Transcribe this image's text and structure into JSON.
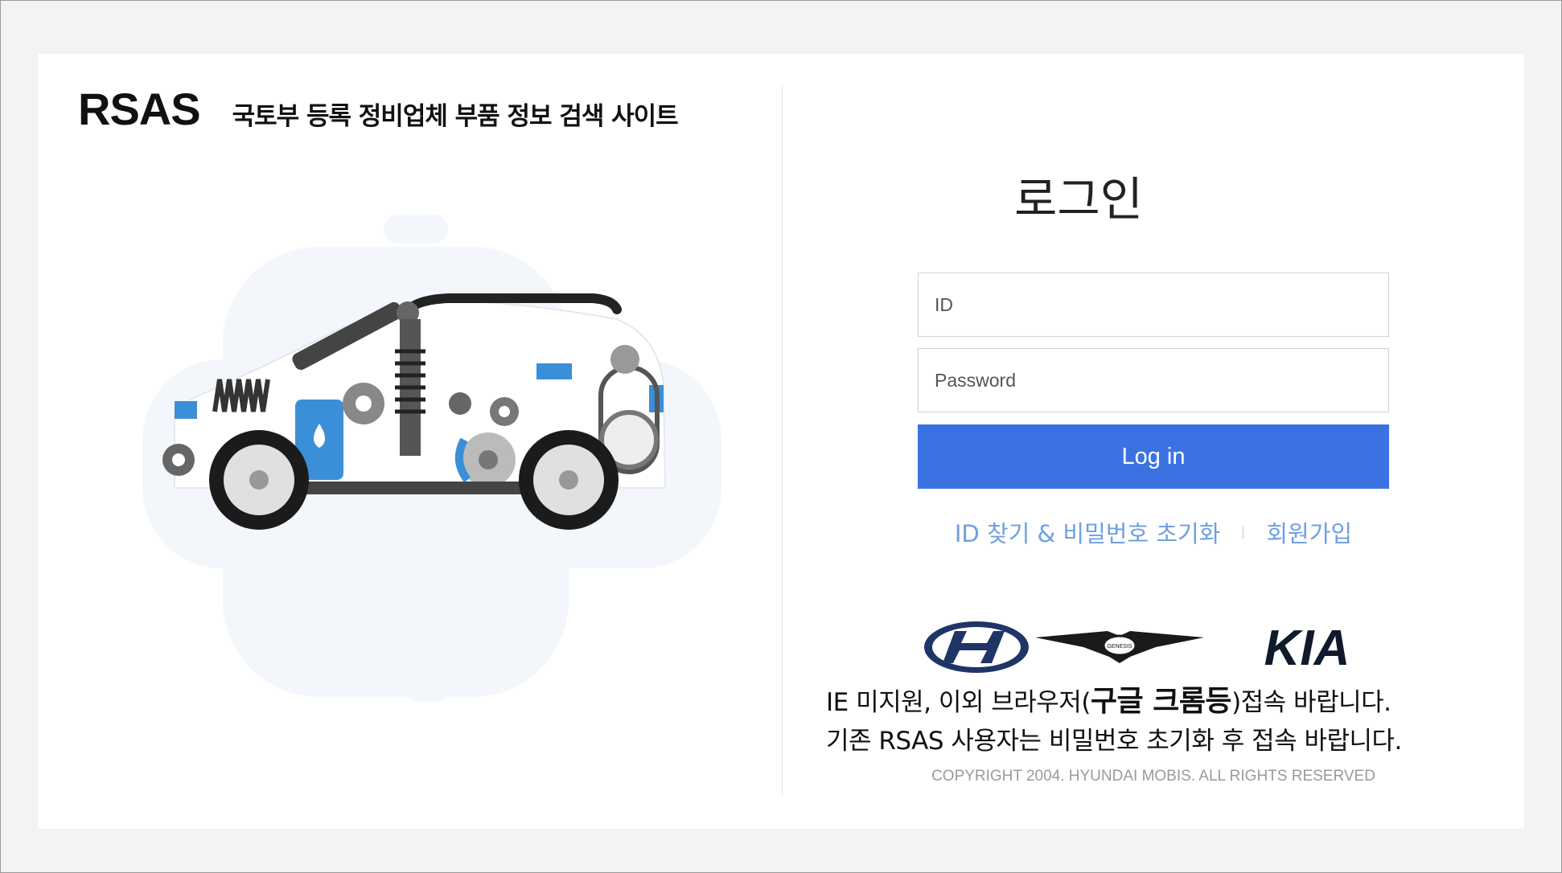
{
  "brand": {
    "logo": "RSAS",
    "subtitle": "국토부 등록 정비업체 부품 정보 검색 사이트"
  },
  "login": {
    "title": "로그인",
    "id_placeholder": "ID",
    "password_placeholder": "Password",
    "button_label": "Log in",
    "find_link": "ID 찾기 & 비밀번호 초기화",
    "signup_link": "회원가입"
  },
  "logos": [
    "hyundai-logo",
    "genesis-logo",
    "kia-logo"
  ],
  "logo_text": {
    "genesis": "GENESIS",
    "kia": "KIA"
  },
  "notice": {
    "line1_prefix": "IE 미지원, 이외 브라우저(",
    "line1_bold": "구글 크롬등",
    "line1_suffix": ")접속 바랍니다.",
    "line2": "기존 RSAS 사용자는 비밀번호 초기화 후 접속 바랍니다."
  },
  "copyright": "COPYRIGHT 2004. HYUNDAI MOBIS. ALL RIGHTS RESERVED",
  "colors": {
    "accent": "#3a73e1",
    "link": "#6f9fe3",
    "logo_navy": "#1e3566",
    "kia_dark": "#0f1a2b"
  }
}
